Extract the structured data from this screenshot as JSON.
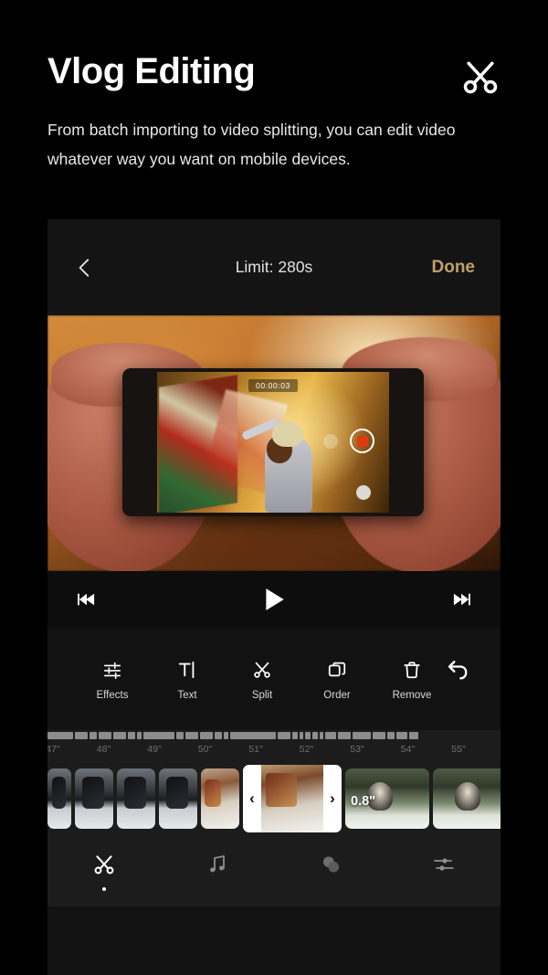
{
  "promo": {
    "title": "Vlog Editing",
    "description": "From batch importing to video splitting, you can edit video whatever way you want on mobile devices.",
    "icon": "scissors-icon"
  },
  "app": {
    "header": {
      "back_icon": "chevron-left-icon",
      "title": "Limit: 280s",
      "done_label": "Done",
      "done_color": "#bfa167"
    },
    "preview": {
      "timecode": "00:00:03",
      "record_icon": "record-stop-icon",
      "record_color": "#e03a10",
      "shutter_icon": "shutter-icon",
      "lens_icon": "lens-icon"
    },
    "playback": {
      "previous_icon": "skip-backward-icon",
      "play_icon": "play-icon",
      "next_icon": "skip-forward-icon"
    },
    "tools": [
      {
        "label": "Effects",
        "icon": "sliders-icon"
      },
      {
        "label": "Text",
        "icon": "text-cursor-icon"
      },
      {
        "label": "Split",
        "icon": "scissors-icon"
      },
      {
        "label": "Order",
        "icon": "layers-icon"
      },
      {
        "label": "Remove",
        "icon": "trash-icon"
      }
    ],
    "undo": {
      "icon": "undo-arrow-icon"
    },
    "overview_segments": [
      28,
      14,
      8,
      14,
      14,
      8,
      5,
      34,
      8,
      14,
      14,
      8,
      5,
      50,
      14,
      6,
      4,
      6,
      6,
      4,
      12,
      14,
      20,
      14,
      8,
      12,
      10
    ],
    "ruler": {
      "ticks": [
        "47\"",
        "48\"",
        "49\"",
        "50\"",
        "51\"",
        "52\"",
        "53\"",
        "54\"",
        "55\""
      ]
    },
    "filmstrip": {
      "left_clips": [
        {
          "style": "snow"
        },
        {
          "style": "snow"
        },
        {
          "style": "snow"
        },
        {
          "style": "snow"
        },
        {
          "style": "warm"
        }
      ],
      "selected_clip": {
        "duration": "0.8\"",
        "left_handle": "‹",
        "right_handle": "›"
      },
      "right_clips": [
        {
          "style": "wedding"
        },
        {
          "style": "wedding"
        },
        {
          "style": "wedding"
        }
      ]
    },
    "tabs": [
      {
        "icon": "scissors-icon",
        "active": true
      },
      {
        "icon": "music-note-icon",
        "active": false
      },
      {
        "icon": "overlay-circles-icon",
        "active": false
      },
      {
        "icon": "adjust-sliders-icon",
        "active": false
      }
    ]
  }
}
